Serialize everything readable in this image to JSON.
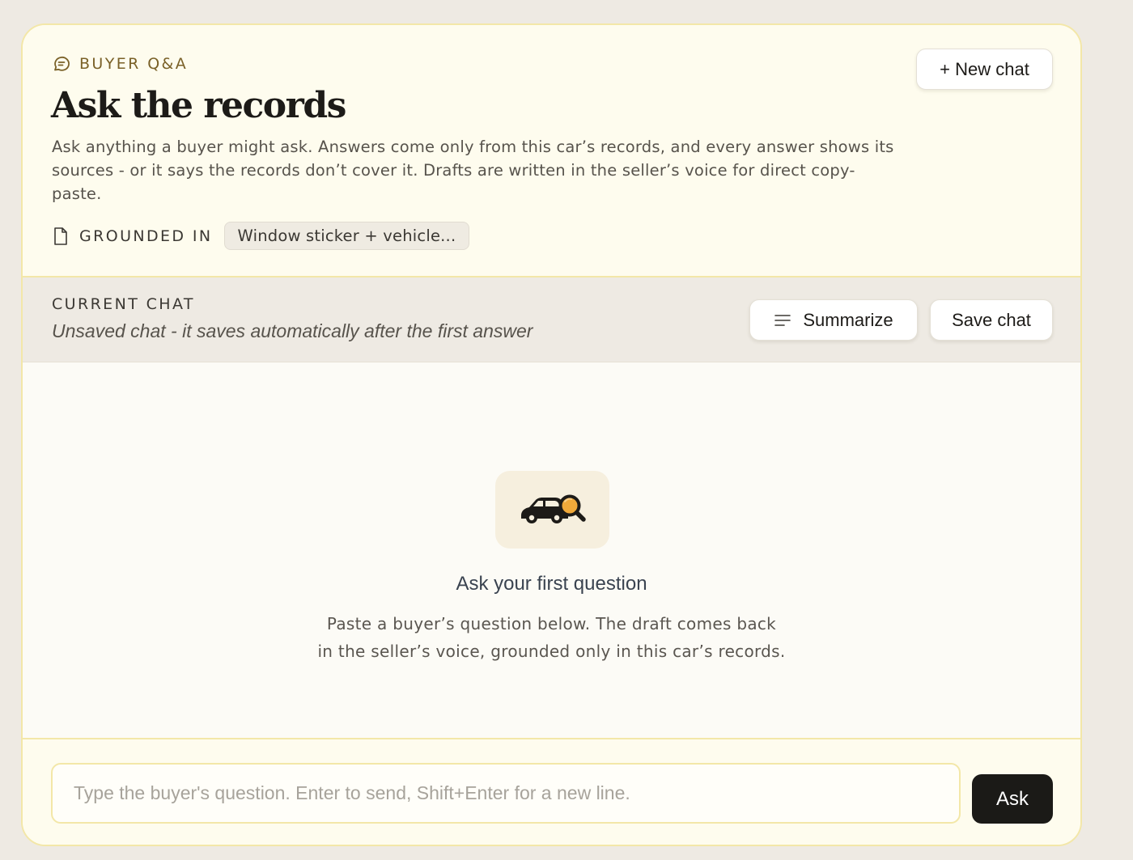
{
  "header": {
    "eyebrow": "BUYER Q&A",
    "eyebrow_icon": "chat-bubble-icon",
    "title": "Ask the records",
    "description": "Ask anything a buyer might ask. Answers come only from this car’s records, and every answer shows its sources - or it says the records don’t cover it. Drafts are written in the seller’s voice for direct copy-paste.",
    "grounded_label": "GROUNDED IN",
    "grounded_icon": "document-icon",
    "grounded_chip": "Window sticker + vehicle...",
    "new_chat_label": "+ New chat"
  },
  "chat_bar": {
    "label": "CURRENT CHAT",
    "status": "Unsaved chat - it saves automatically after the first answer",
    "summarize_label": "Summarize",
    "summarize_icon": "lines-icon",
    "save_label": "Save chat"
  },
  "empty_state": {
    "icon": "car-search-icon",
    "title": "Ask your first question",
    "line1": "Paste a buyer’s question below. The draft comes back",
    "line2": "in the seller’s voice, grounded only in this car’s records."
  },
  "composer": {
    "placeholder": "Type the buyer's question. Enter to send, Shift+Enter for a new line.",
    "value": "",
    "ask_label": "Ask"
  },
  "colors": {
    "accent_brown": "#7a6128",
    "border_yellow": "#f3e7a8",
    "header_bg": "#fefcee",
    "ask_button_bg": "#1b1a17"
  }
}
